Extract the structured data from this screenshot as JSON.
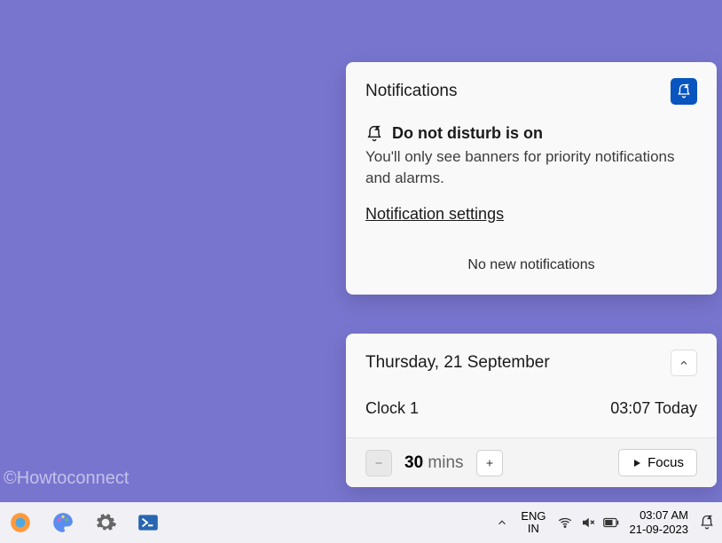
{
  "notifications": {
    "title": "Notifications",
    "dnd_title": "Do not disturb is on",
    "dnd_body": "You'll only see banners for priority notifications and alarms.",
    "settings_link": "Notification settings",
    "empty": "No new notifications"
  },
  "calendar": {
    "date": "Thursday, 21 September",
    "clock_label": "Clock 1",
    "clock_value": "03:07 Today",
    "focus": {
      "duration_num": "30",
      "duration_unit": "mins",
      "button": "Focus"
    }
  },
  "watermark": "©Howtoconnect",
  "taskbar": {
    "lang_top": "ENG",
    "lang_bottom": "IN",
    "time": "03:07 AM",
    "date": "21-09-2023"
  }
}
